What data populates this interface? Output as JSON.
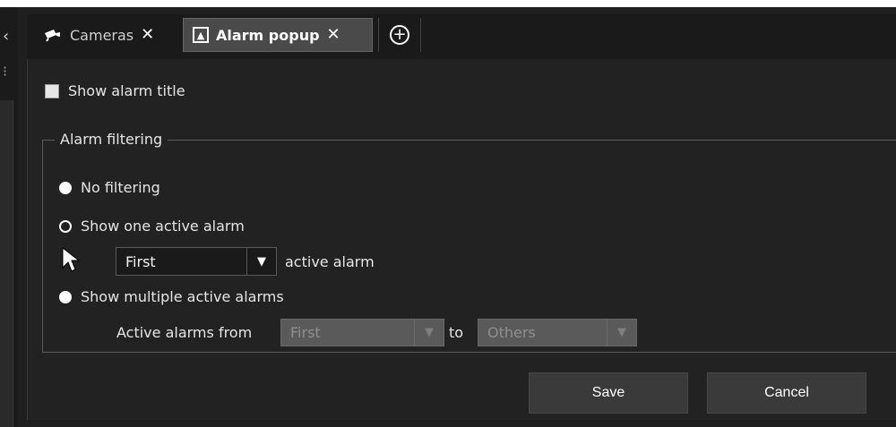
{
  "tabs": [
    {
      "label": "Cameras",
      "icon": "camera-icon"
    },
    {
      "label": "Alarm popup",
      "icon": "alarm-bell-icon",
      "active": true
    }
  ],
  "add_tab_icon": "add-tab-icon",
  "options": {
    "show_alarm_title": {
      "label": "Show alarm title",
      "checked": true
    }
  },
  "alarm_filtering": {
    "legend": "Alarm filtering",
    "radios": [
      {
        "label": "No filtering",
        "selected": false
      },
      {
        "label": "Show one active alarm",
        "selected": true
      },
      {
        "label": "Show multiple active alarms",
        "selected": false
      }
    ],
    "one_active": {
      "selected": "First",
      "suffix": "active alarm"
    },
    "multiple": {
      "from_label": "Active alarms from",
      "from_value": "First",
      "to_label": "to",
      "to_value": "Others"
    }
  },
  "buttons": {
    "save": "Save",
    "cancel": "Cancel"
  },
  "colors": {
    "background": "#222222",
    "tab_active": "#4a4a4a",
    "button": "#3a3a3a",
    "disabled_select": "#5a5a5a"
  }
}
